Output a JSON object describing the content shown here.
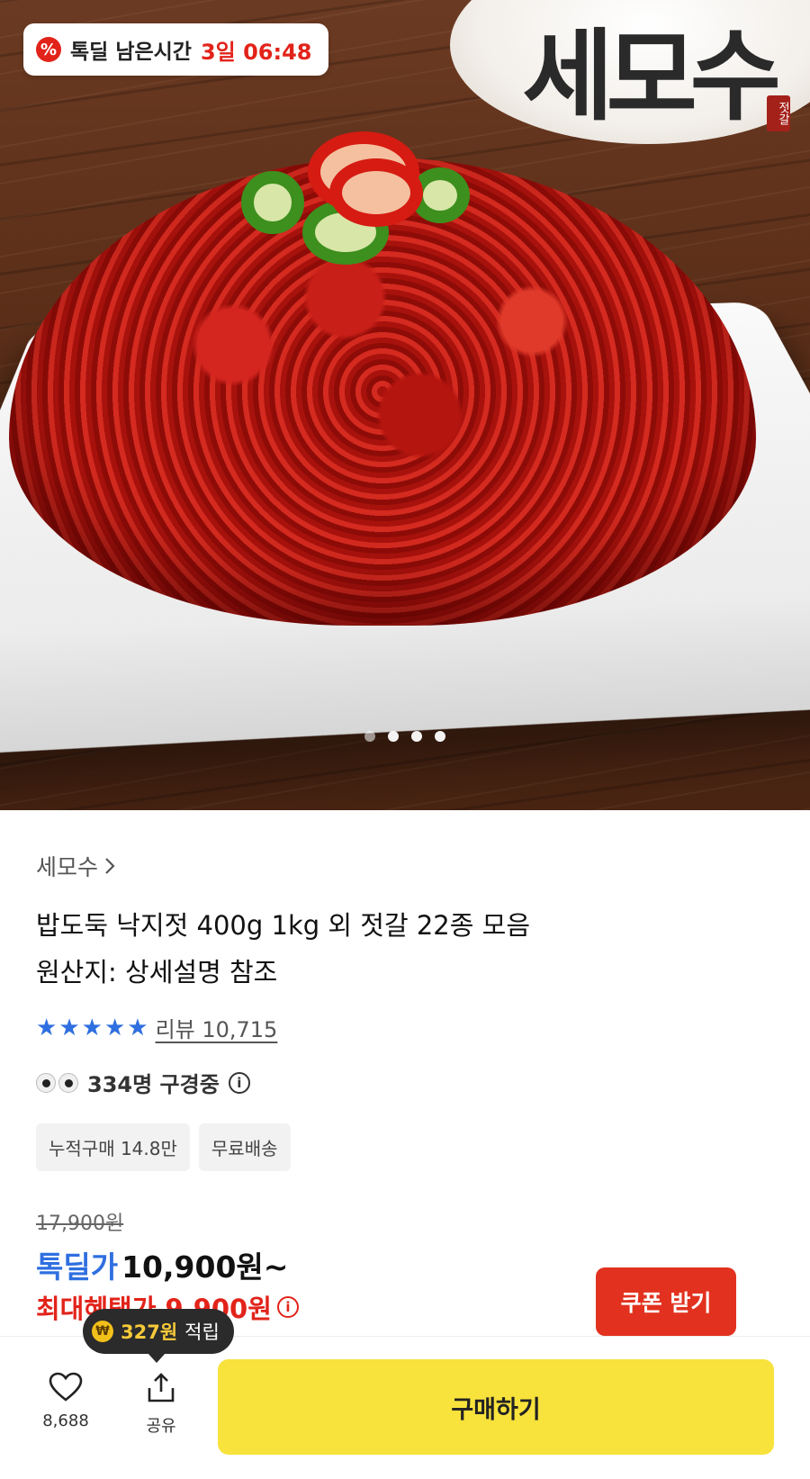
{
  "hero": {
    "brand_logo": "세모수",
    "logo_sub": "젓갈",
    "timer_label": "톡딜 남은시간",
    "timer_value": "3일 06:48",
    "slides_total": 4,
    "slide_active": 1
  },
  "product": {
    "brand": "세모수",
    "title_line1": "밥도둑 낙지젓 400g 1kg 외 젓갈 22종 모음",
    "title_line2": "원산지: 상세설명 참조",
    "review_label": "리뷰 10,715",
    "viewers": "334명 구경중",
    "tags": [
      "누적구매 14.8만",
      "무료배송"
    ]
  },
  "price": {
    "original": "17,900원",
    "deal_label": "톡딜가",
    "deal_price": "10,900원~",
    "max_benefit": "최대혜택가 9,900원",
    "coupon_button": "쿠폰 받기"
  },
  "points_tooltip": {
    "amount": "327원",
    "suffix": "적립"
  },
  "bottom": {
    "like_count": "8,688",
    "share_label": "공유",
    "buy_label": "구매하기"
  },
  "colors": {
    "accent_red": "#e2231a",
    "accent_blue": "#2f6fe0",
    "buy_yellow": "#f8e23c"
  }
}
